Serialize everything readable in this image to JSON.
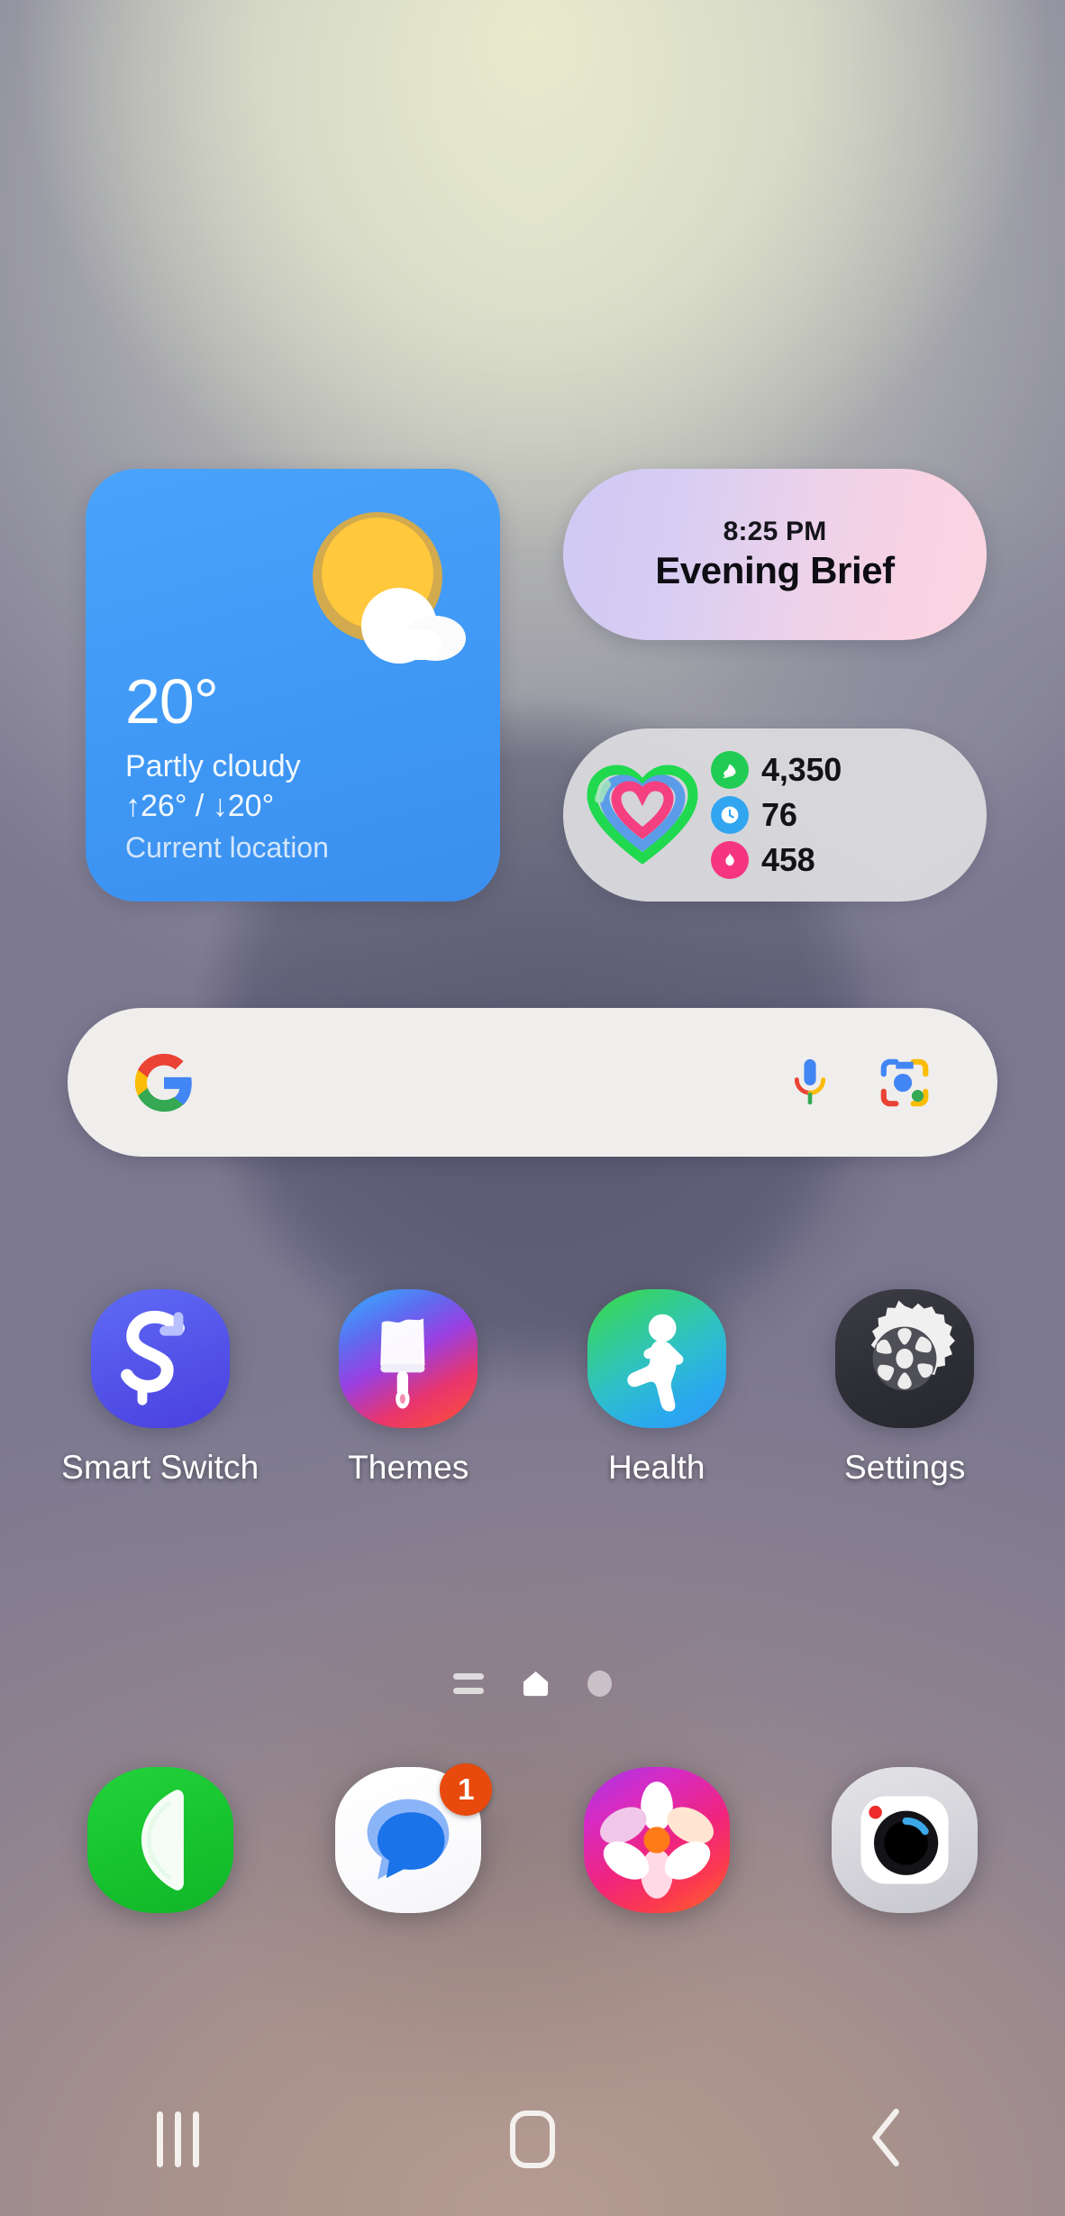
{
  "wallpaper": {
    "top_color": "#c9cfd4",
    "mid_color": "#787c94",
    "bottom_color": "#b39a91",
    "highlight_color": "#eaecd0"
  },
  "widgets": {
    "weather": {
      "name": "weather-widget",
      "icon": "sun-behind-cloud-icon",
      "temperature": "20°",
      "condition": "Partly cloudy",
      "high_low": "↑26° / ↓20°",
      "location": "Current location",
      "bg_color": "#3f98f5"
    },
    "brief": {
      "name": "evening-brief-widget",
      "time": "8:25 PM",
      "title": "Evening Brief",
      "gradient_start": "#cfc9f4",
      "gradient_end": "#fbd5e1"
    },
    "health": {
      "name": "health-widget",
      "icon": "heart-activity-rings-icon",
      "stats": [
        {
          "icon": "steps-shoe-icon",
          "value": "4,350",
          "color": "#21cc54"
        },
        {
          "icon": "active-time-clock-icon",
          "value": "76",
          "color": "#32a5f0"
        },
        {
          "icon": "calories-flame-icon",
          "value": "458",
          "color": "#f5357f"
        }
      ]
    }
  },
  "search": {
    "name": "google-search-bar",
    "value": "",
    "placeholder": "",
    "logo": "google-g-icon",
    "mic": "microphone-icon",
    "lens": "google-lens-icon",
    "bg_color": "#efeeec"
  },
  "apps": [
    {
      "name": "smart-switch",
      "label": "Smart Switch",
      "icon": "smart-switch-icon"
    },
    {
      "name": "themes",
      "label": "Themes",
      "icon": "themes-paintbrush-icon"
    },
    {
      "name": "health",
      "label": "Health",
      "icon": "samsung-health-runner-icon"
    },
    {
      "name": "settings",
      "label": "Settings",
      "icon": "settings-gear-icon"
    }
  ],
  "page_indicator": {
    "apps_button": "app-list-lines-icon",
    "home_page": "home-pentagon-icon",
    "other_page": "page-dot-icon",
    "current_page": 1,
    "total_pages": 2
  },
  "dock": [
    {
      "name": "phone",
      "icon": "phone-handset-icon",
      "badge": ""
    },
    {
      "name": "messages",
      "icon": "messages-bubble-icon",
      "badge": "1"
    },
    {
      "name": "gallery",
      "icon": "gallery-flower-icon",
      "badge": ""
    },
    {
      "name": "camera",
      "icon": "camera-lens-icon",
      "badge": ""
    }
  ],
  "nav_bar": {
    "recents": "recents-icon",
    "home": "home-square-icon",
    "back": "back-chevron-icon"
  }
}
